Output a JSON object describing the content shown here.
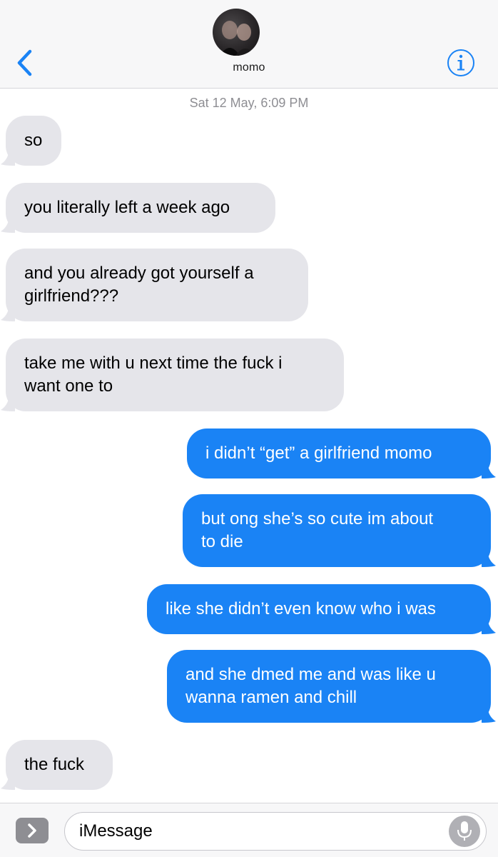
{
  "header": {
    "contact_name": "momo"
  },
  "conversation": {
    "timestamp": "Sat 12 May, 6:09 PM",
    "messages": [
      {
        "side": "incoming",
        "lines": [
          "so"
        ]
      },
      {
        "side": "incoming",
        "lines": [
          "you literally left a week ago"
        ]
      },
      {
        "side": "incoming",
        "lines": [
          "and you already got yourself a",
          "girlfriend???"
        ]
      },
      {
        "side": "incoming",
        "lines": [
          "take me with u next time the fuck i",
          "want one to"
        ]
      },
      {
        "side": "outgoing",
        "lines": [
          "i didn’t “get” a girlfriend momo"
        ]
      },
      {
        "side": "outgoing",
        "lines": [
          "but ong she’s so cute im about",
          "to die"
        ]
      },
      {
        "side": "outgoing",
        "lines": [
          "like she didn’t even know who i was"
        ]
      },
      {
        "side": "outgoing",
        "lines": [
          "and she dmed me and was like u",
          "wanna ramen and chill"
        ]
      },
      {
        "side": "incoming",
        "lines": [
          "the fuck"
        ]
      }
    ]
  },
  "input_bar": {
    "placeholder": "iMessage"
  },
  "icons": {
    "back": "chevron-left-icon",
    "info": "info-icon",
    "apps": "chevron-right-icon",
    "mic": "microphone-icon"
  },
  "colors": {
    "accent": "#1a83f5",
    "incoming_bubble": "#e5e5ea",
    "outgoing_bubble": "#1a83f5",
    "secondary_text": "#8e8e93"
  }
}
